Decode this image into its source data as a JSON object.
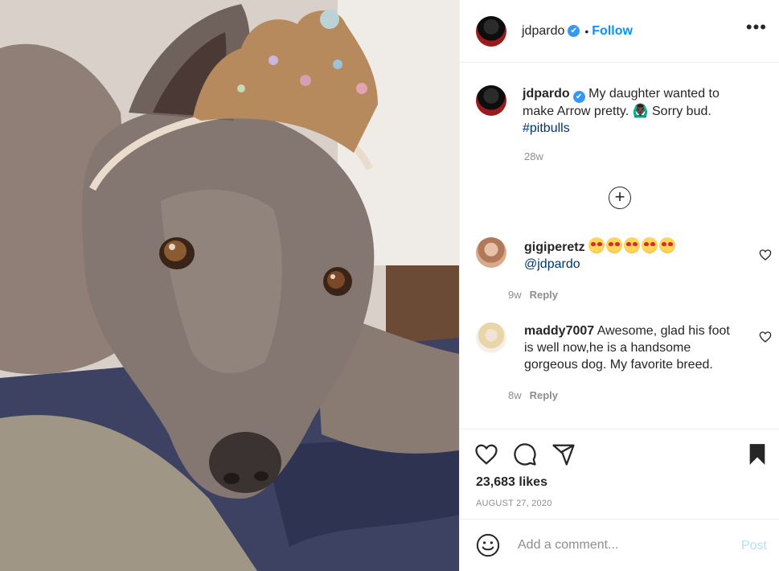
{
  "post": {
    "author": "jdpardo",
    "follow_label": "Follow",
    "dot": "•",
    "more_label": "•••",
    "image_alt": "Grey pit bull wearing a glittery tiara lying on a rug",
    "caption": {
      "username": "jdpardo",
      "text": " My daughter wanted to make Arrow pretty. 🙆🏿‍♂️ Sorry bud. ",
      "hashtag": "#pitbulls",
      "time": "28w"
    },
    "load_more_label": "+",
    "comments": [
      {
        "username": "gigiperetz",
        "mention": "@jdpardo",
        "time": "9w",
        "reply_label": "Reply",
        "emoji_name": "heart-eyes-emoji",
        "emoji_count": 5
      },
      {
        "username": "maddy7007",
        "text": " Awesome, glad his foot is well now,he is a handsome gorgeous dog. My favorite breed.",
        "time": "8w",
        "reply_label": "Reply"
      }
    ],
    "likes": "23,683 likes",
    "date": "AUGUST 27, 2020",
    "add_comment": {
      "placeholder": "Add a comment...",
      "post_label": "Post"
    }
  },
  "colors": {
    "accent": "#0095f6",
    "text": "#262626",
    "muted": "#8e8e8e",
    "post_disabled": "#b2dffc",
    "verified": "#3897f0"
  },
  "icons": [
    "verified-badge-icon",
    "more-options-icon",
    "load-more-icon",
    "heart-icon",
    "comment-icon",
    "share-icon",
    "bookmark-icon",
    "emoji-icon"
  ]
}
